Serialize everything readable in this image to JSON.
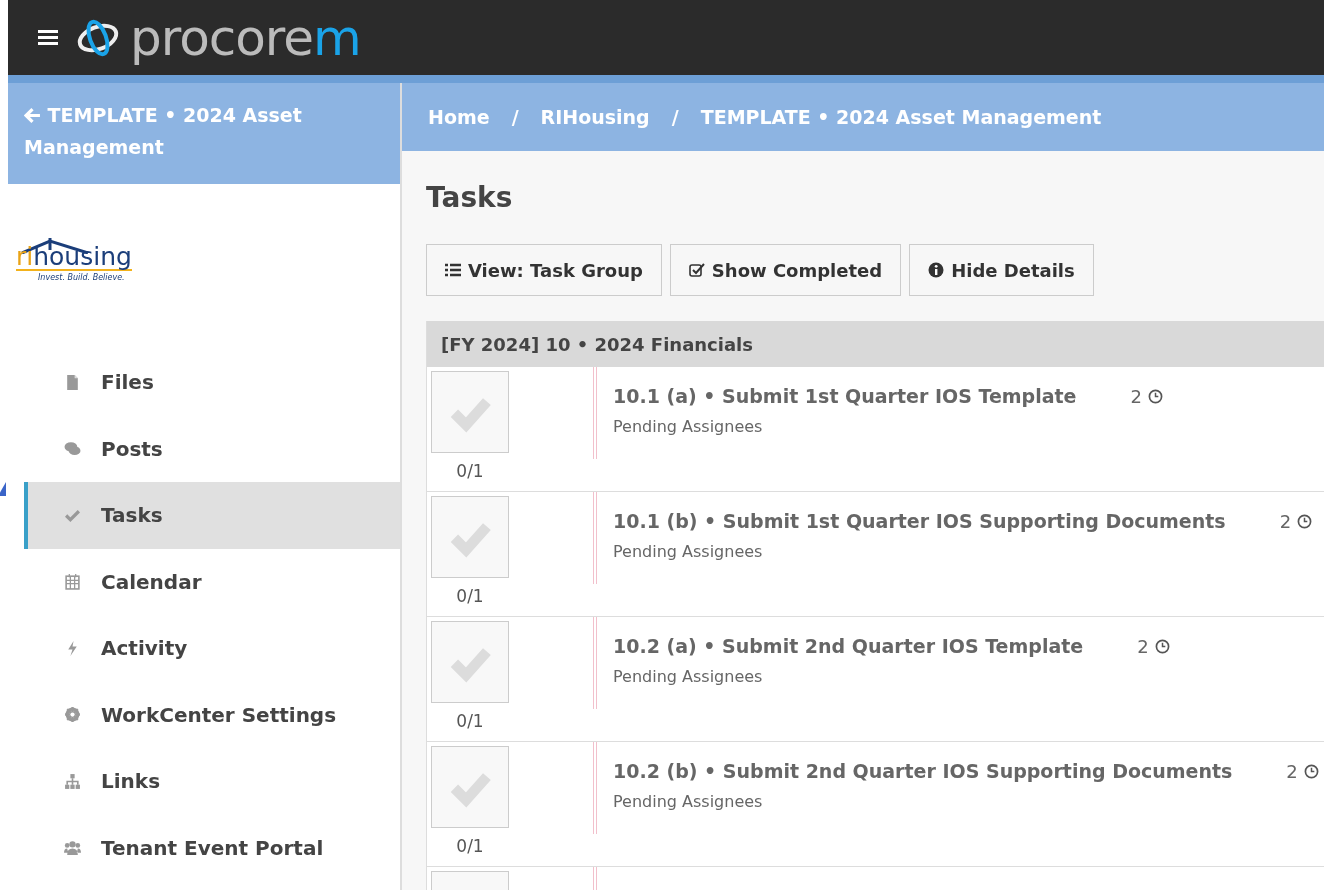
{
  "logo": {
    "text": "procore",
    "accent": "m"
  },
  "sidebar": {
    "back_title": "TEMPLATE • 2024 Asset Management",
    "brand": {
      "name_accent": "ri",
      "name": "housing",
      "tagline": "Invest. Build. Believe."
    },
    "items": [
      {
        "label": "Files",
        "selected": false
      },
      {
        "label": "Posts",
        "selected": false
      },
      {
        "label": "Tasks",
        "selected": true
      },
      {
        "label": "Calendar",
        "selected": false
      },
      {
        "label": "Activity",
        "selected": false
      },
      {
        "label": "WorkCenter Settings",
        "selected": false
      },
      {
        "label": "Links",
        "selected": false
      },
      {
        "label": "Tenant Event Portal",
        "selected": false
      }
    ]
  },
  "breadcrumbs": [
    {
      "label": "Home"
    },
    {
      "separator": "/",
      "label": "RIHousing"
    },
    {
      "separator": "/",
      "label": "TEMPLATE • 2024 Asset Management"
    }
  ],
  "page_title": "Tasks",
  "toolbar": [
    {
      "label": "View: Task Group"
    },
    {
      "label": "Show Completed"
    },
    {
      "label": "Hide Details"
    }
  ],
  "group": {
    "title": "[FY 2024] 10 • 2024 Financials",
    "tasks": [
      {
        "title": "10.1 (a) • Submit 1st Quarter IOS Template",
        "status": "Pending Assignees",
        "count": "2",
        "progress": "0/1",
        "checked": false
      },
      {
        "title": "10.1 (b) • Submit 1st Quarter IOS Supporting Documents",
        "status": "Pending Assignees",
        "count": "2",
        "progress": "0/1",
        "checked": false
      },
      {
        "title": "10.2 (a) • Submit 2nd Quarter IOS Template",
        "status": "Pending Assignees",
        "count": "2",
        "progress": "0/1",
        "checked": false
      },
      {
        "title": "10.2 (b) • Submit 2nd Quarter IOS Supporting Documents",
        "status": "Pending Assignees",
        "count": "2",
        "progress": "0/1",
        "checked": false
      }
    ],
    "partial_row": {
      "checked": false
    }
  }
}
